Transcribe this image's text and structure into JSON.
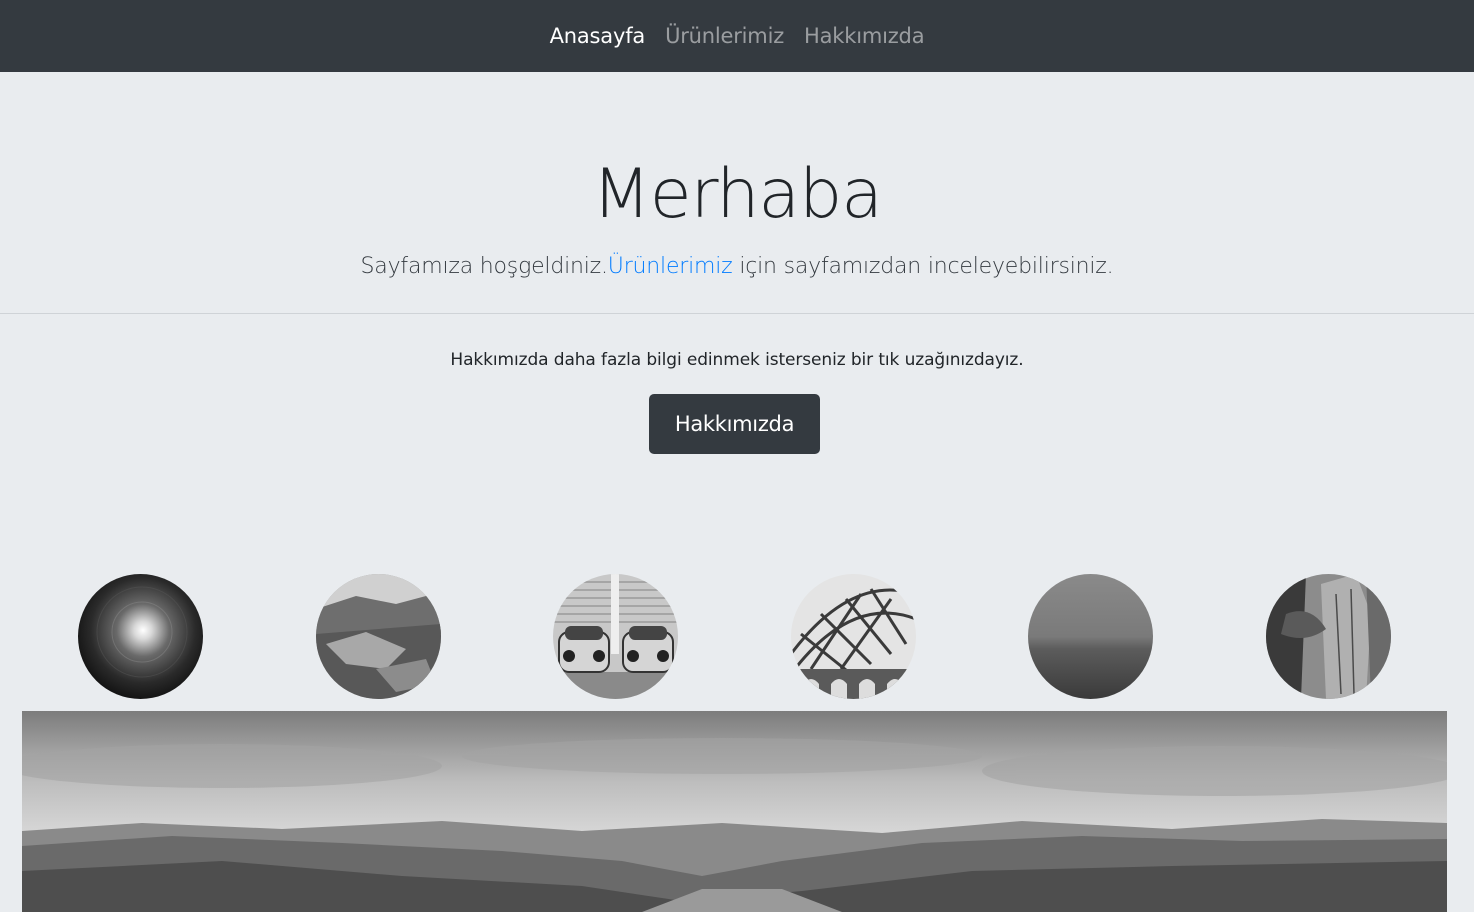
{
  "nav": {
    "items": [
      {
        "label": "Anasayfa",
        "active": true
      },
      {
        "label": "Ürünlerimiz",
        "active": false
      },
      {
        "label": "Hakkımızda",
        "active": false
      }
    ]
  },
  "hero": {
    "title": "Merhaba",
    "lead_before": "Sayfamıza hoşgeldiniz.",
    "lead_link": "Ürünlerimiz",
    "lead_after": " için sayfamızdan inceleyebilirsiniz."
  },
  "info": {
    "text": "Hakkımızda daha fazla bilgi edinmek isterseniz bir tık uzağınızdayız.",
    "button_label": "Hakkımızda"
  },
  "colors": {
    "navbar_bg": "#343a40",
    "page_bg": "#e9ecef",
    "link": "#007bff",
    "button_bg": "#343a40"
  }
}
